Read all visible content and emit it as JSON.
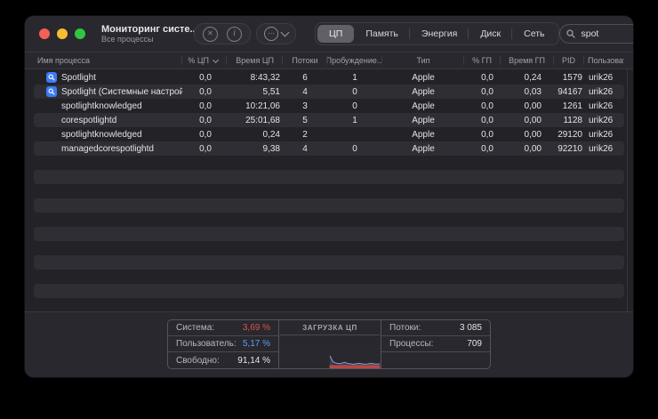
{
  "window": {
    "title": "Мониторинг систе...",
    "subtitle": "Все процессы"
  },
  "icons": {
    "stop": "✕",
    "info": "i",
    "view_dots": "⋯",
    "clear": "✕"
  },
  "colors": {
    "system_red": "#d9534f",
    "user_blue": "#5f9df6",
    "free_white": "#e6e5e9",
    "spotlight_icon_blue": "#3b7cf6",
    "selected_tab_gray": "#616067"
  },
  "toolbar": {
    "tabs": [
      {
        "label": "ЦП",
        "selected": true
      },
      {
        "label": "Память",
        "selected": false
      },
      {
        "label": "Энергия",
        "selected": false
      },
      {
        "label": "Диск",
        "selected": false
      },
      {
        "label": "Сеть",
        "selected": false
      }
    ],
    "search": {
      "value": "spot"
    }
  },
  "table": {
    "columns": [
      {
        "key": "name",
        "label": "Имя процесса",
        "align": "left",
        "sorted": false
      },
      {
        "key": "cpu",
        "label": "% ЦП",
        "align": "right",
        "sorted": true
      },
      {
        "key": "cputime",
        "label": "Время ЦП",
        "align": "right",
        "sorted": false
      },
      {
        "key": "threads",
        "label": "Потоки",
        "align": "center",
        "sorted": false
      },
      {
        "key": "wake",
        "label": "Пробуждение...",
        "align": "center",
        "sorted": false
      },
      {
        "key": "type",
        "label": "Тип",
        "align": "center",
        "sorted": false
      },
      {
        "key": "gpu",
        "label": "% ГП",
        "align": "right",
        "sorted": false
      },
      {
        "key": "gputime",
        "label": "Время ГП",
        "align": "right",
        "sorted": false
      },
      {
        "key": "pid",
        "label": "PID",
        "align": "right",
        "sorted": false
      },
      {
        "key": "user",
        "label": "Пользоват...",
        "align": "left",
        "sorted": false
      }
    ],
    "rows": [
      {
        "icon": true,
        "name": "Spotlight",
        "cpu": "0,0",
        "cputime": "8:43,32",
        "threads": "6",
        "wake": "1",
        "type": "Apple",
        "gpu": "0,0",
        "gputime": "0,24",
        "pid": "1579",
        "user": "urik26"
      },
      {
        "icon": true,
        "name": "Spotlight (Системные настройки)",
        "cpu": "0,0",
        "cputime": "5,51",
        "threads": "4",
        "wake": "0",
        "type": "Apple",
        "gpu": "0,0",
        "gputime": "0,03",
        "pid": "94167",
        "user": "urik26"
      },
      {
        "icon": false,
        "name": "spotlightknowledged",
        "cpu": "0,0",
        "cputime": "10:21,06",
        "threads": "3",
        "wake": "0",
        "type": "Apple",
        "gpu": "0,0",
        "gputime": "0,00",
        "pid": "1261",
        "user": "urik26"
      },
      {
        "icon": false,
        "name": "corespotlightd",
        "cpu": "0,0",
        "cputime": "25:01,68",
        "threads": "5",
        "wake": "1",
        "type": "Apple",
        "gpu": "0,0",
        "gputime": "0,00",
        "pid": "1128",
        "user": "urik26"
      },
      {
        "icon": false,
        "name": "spotlightknowledged",
        "cpu": "0,0",
        "cputime": "0,24",
        "threads": "2",
        "wake": "",
        "type": "Apple",
        "gpu": "0,0",
        "gputime": "0,00",
        "pid": "29120",
        "user": "urik26"
      },
      {
        "icon": false,
        "name": "managedcorespotlightd",
        "cpu": "0,0",
        "cputime": "9,38",
        "threads": "4",
        "wake": "0",
        "type": "Apple",
        "gpu": "0,0",
        "gputime": "0,00",
        "pid": "92210",
        "user": "urik26"
      }
    ],
    "empty_row_count": 11
  },
  "footer": {
    "stats": [
      {
        "label": "Система:",
        "value": "3,69 %",
        "color": "#d9534f"
      },
      {
        "label": "Пользователь:",
        "value": "5,17 %",
        "color": "#5f9df6"
      },
      {
        "label": "Свободно:",
        "value": "91,14 %",
        "color": "#e6e5e9"
      }
    ],
    "cpu_load_title": "ЗАГРУЗКА ЦП",
    "counts": [
      {
        "label": "Потоки:",
        "value": "3 085"
      },
      {
        "label": "Процессы:",
        "value": "709"
      }
    ],
    "cpu_load_graph": {
      "start_frac": 0.5,
      "total": [
        14,
        7.5,
        6,
        5.2,
        5.6,
        6.8,
        5.4,
        5,
        4.6,
        5,
        5.6,
        5,
        4.6,
        4.9,
        5.5,
        5,
        4.7,
        5.2
      ],
      "system": [
        3.2,
        3,
        2.8,
        3,
        3,
        3.4,
        3,
        2.8,
        3,
        3,
        3.3,
        3,
        2.8,
        3,
        3.3,
        3,
        2.9,
        3.1
      ]
    }
  }
}
